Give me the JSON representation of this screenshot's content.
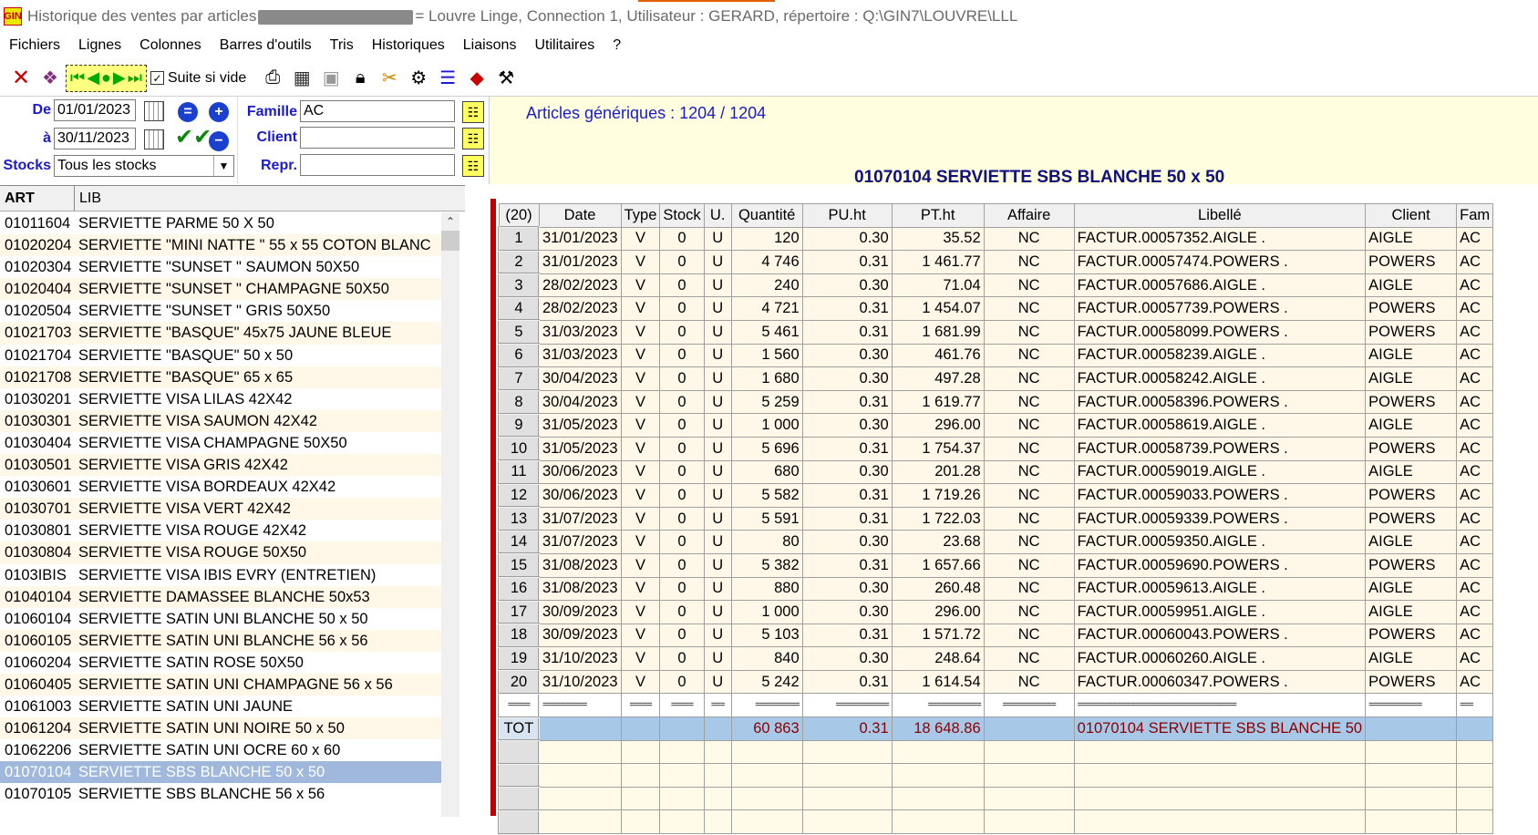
{
  "window": {
    "title_prefix": "Historique des ventes par articles",
    "title_suffix": "= Louvre Linge, Connection 1, Utilisateur : GERARD, répertoire : Q:\\GIN7\\LOUVRE\\LLL",
    "app_icon_text": "GIN"
  },
  "menu": [
    "Fichiers",
    "Lignes",
    "Colonnes",
    "Barres d'outils",
    "Tris",
    "Historiques",
    "Liaisons",
    "Utilitaires",
    "?"
  ],
  "toolbar": {
    "suite_label": "Suite si vide",
    "suite_checked": "✓",
    "nav_first": "⏮",
    "nav_prev": "◀",
    "nav_dot": "●",
    "nav_next": "▶",
    "nav_last": "⏭"
  },
  "filters": {
    "de_label": "De",
    "de_value": "01/01/2023",
    "a_label": "à",
    "a_value": "30/11/2023",
    "stocks_label": "Stocks",
    "stocks_value": "Tous les stocks",
    "famille_label": "Famille",
    "famille_value": "AC",
    "client_label": "Client",
    "client_value": "",
    "repr_label": "Repr.",
    "repr_value": ""
  },
  "info": {
    "count": "Articles génériques : 1204 / 1204",
    "article": "01070104 SERVIETTE SBS  BLANCHE 50 x 50"
  },
  "list": {
    "header_art": "ART",
    "header_lib": "LIB",
    "rows": [
      {
        "art": "01011604",
        "lib": "SERVIETTE  PARME 50 X 50"
      },
      {
        "art": "01020204",
        "lib": "SERVIETTE  \"MINI NATTE \" 55 x 55 COTON BLANC"
      },
      {
        "art": "01020304",
        "lib": "SERVIETTE  \"SUNSET \"  SAUMON 50X50"
      },
      {
        "art": "01020404",
        "lib": "SERVIETTE  \"SUNSET \"  CHAMPAGNE 50X50"
      },
      {
        "art": "01020504",
        "lib": "SERVIETTE  \"SUNSET \" GRIS 50X50"
      },
      {
        "art": "01021703",
        "lib": "SERVIETTE \"BASQUE\" 45x75 JAUNE BLEUE"
      },
      {
        "art": "01021704",
        "lib": "SERVIETTE  \"BASQUE\"  50 x 50"
      },
      {
        "art": "01021708",
        "lib": "SERVIETTE \"BASQUE\"  65 x 65"
      },
      {
        "art": "01030201",
        "lib": "SERVIETTE VISA  LILAS 42X42"
      },
      {
        "art": "01030301",
        "lib": "SERVIETTE VISA SAUMON 42X42"
      },
      {
        "art": "01030404",
        "lib": "SERVIETTE VISA CHAMPAGNE 50X50"
      },
      {
        "art": "01030501",
        "lib": "SERVIETTE VISA GRIS 42X42"
      },
      {
        "art": "01030601",
        "lib": "SERVIETTE VISA BORDEAUX 42X42"
      },
      {
        "art": "01030701",
        "lib": "SERVIETTE VISA VERT 42X42"
      },
      {
        "art": "01030801",
        "lib": "SERVIETTE VISA ROUGE 42X42"
      },
      {
        "art": "01030804",
        "lib": "SERVIETTE VISA ROUGE 50X50"
      },
      {
        "art": "0103IBIS",
        "lib": "SERVIETTE VISA IBIS EVRY (ENTRETIEN)"
      },
      {
        "art": "01040104",
        "lib": "SERVIETTE DAMASSEE BLANCHE 50x53"
      },
      {
        "art": "01060104",
        "lib": "SERVIETTE SATIN UNI BLANCHE 50 x 50"
      },
      {
        "art": "01060105",
        "lib": "SERVIETTE SATIN UNI BLANCHE 56 x 56"
      },
      {
        "art": "01060204",
        "lib": "SERVIETTE SATIN ROSE 50X50"
      },
      {
        "art": "01060405",
        "lib": "SERVIETTE SATIN UNI CHAMPAGNE 56 x 56"
      },
      {
        "art": "01061003",
        "lib": "SERVIETTE SATIN UNI JAUNE"
      },
      {
        "art": "01061204",
        "lib": "SERVIETTE SATIN UNI NOIRE 50 x 50"
      },
      {
        "art": "01062206",
        "lib": "SERVIETTE SATIN UNI OCRE 60 x 60"
      },
      {
        "art": "01070104",
        "lib": "SERVIETTE SBS  BLANCHE 50 x 50",
        "selected": true
      },
      {
        "art": "01070105",
        "lib": "SERVIETTE SBS  BLANCHE 56 x 56"
      }
    ]
  },
  "grid": {
    "columns": [
      "(20)",
      "Date",
      "Type",
      "Stock",
      "U.",
      "Quantité",
      "PU.ht",
      "PT.ht",
      "Affaire",
      "Libellé",
      "Client",
      "Fam"
    ],
    "rows": [
      [
        "1",
        "31/01/2023",
        "V",
        "0",
        "U",
        "120",
        "0.30",
        "35.52",
        "NC",
        "FACTUR.00057352.AIGLE  .",
        "AIGLE",
        "AC"
      ],
      [
        "2",
        "31/01/2023",
        "V",
        "0",
        "U",
        "4 746",
        "0.31",
        "1 461.77",
        "NC",
        "FACTUR.00057474.POWERS .",
        "POWERS",
        "AC"
      ],
      [
        "3",
        "28/02/2023",
        "V",
        "0",
        "U",
        "240",
        "0.30",
        "71.04",
        "NC",
        "FACTUR.00057686.AIGLE  .",
        "AIGLE",
        "AC"
      ],
      [
        "4",
        "28/02/2023",
        "V",
        "0",
        "U",
        "4 721",
        "0.31",
        "1 454.07",
        "NC",
        "FACTUR.00057739.POWERS .",
        "POWERS",
        "AC"
      ],
      [
        "5",
        "31/03/2023",
        "V",
        "0",
        "U",
        "5 461",
        "0.31",
        "1 681.99",
        "NC",
        "FACTUR.00058099.POWERS .",
        "POWERS",
        "AC"
      ],
      [
        "6",
        "31/03/2023",
        "V",
        "0",
        "U",
        "1 560",
        "0.30",
        "461.76",
        "NC",
        "FACTUR.00058239.AIGLE  .",
        "AIGLE",
        "AC"
      ],
      [
        "7",
        "30/04/2023",
        "V",
        "0",
        "U",
        "1 680",
        "0.30",
        "497.28",
        "NC",
        "FACTUR.00058242.AIGLE  .",
        "AIGLE",
        "AC"
      ],
      [
        "8",
        "30/04/2023",
        "V",
        "0",
        "U",
        "5 259",
        "0.31",
        "1 619.77",
        "NC",
        "FACTUR.00058396.POWERS .",
        "POWERS",
        "AC"
      ],
      [
        "9",
        "31/05/2023",
        "V",
        "0",
        "U",
        "1 000",
        "0.30",
        "296.00",
        "NC",
        "FACTUR.00058619.AIGLE  .",
        "AIGLE",
        "AC"
      ],
      [
        "10",
        "31/05/2023",
        "V",
        "0",
        "U",
        "5 696",
        "0.31",
        "1 754.37",
        "NC",
        "FACTUR.00058739.POWERS .",
        "POWERS",
        "AC"
      ],
      [
        "11",
        "30/06/2023",
        "V",
        "0",
        "U",
        "680",
        "0.30",
        "201.28",
        "NC",
        "FACTUR.00059019.AIGLE  .",
        "AIGLE",
        "AC"
      ],
      [
        "12",
        "30/06/2023",
        "V",
        "0",
        "U",
        "5 582",
        "0.31",
        "1 719.26",
        "NC",
        "FACTUR.00059033.POWERS .",
        "POWERS",
        "AC"
      ],
      [
        "13",
        "31/07/2023",
        "V",
        "0",
        "U",
        "5 591",
        "0.31",
        "1 722.03",
        "NC",
        "FACTUR.00059339.POWERS .",
        "POWERS",
        "AC"
      ],
      [
        "14",
        "31/07/2023",
        "V",
        "0",
        "U",
        "80",
        "0.30",
        "23.68",
        "NC",
        "FACTUR.00059350.AIGLE  .",
        "AIGLE",
        "AC"
      ],
      [
        "15",
        "31/08/2023",
        "V",
        "0",
        "U",
        "5 382",
        "0.31",
        "1 657.66",
        "NC",
        "FACTUR.00059690.POWERS .",
        "POWERS",
        "AC"
      ],
      [
        "16",
        "31/08/2023",
        "V",
        "0",
        "U",
        "880",
        "0.30",
        "260.48",
        "NC",
        "FACTUR.00059613.AIGLE  .",
        "AIGLE",
        "AC"
      ],
      [
        "17",
        "30/09/2023",
        "V",
        "0",
        "U",
        "1 000",
        "0.30",
        "296.00",
        "NC",
        "FACTUR.00059951.AIGLE  .",
        "AIGLE",
        "AC"
      ],
      [
        "18",
        "30/09/2023",
        "V",
        "0",
        "U",
        "5 103",
        "0.31",
        "1 571.72",
        "NC",
        "FACTUR.00060043.POWERS .",
        "POWERS",
        "AC"
      ],
      [
        "19",
        "31/10/2023",
        "V",
        "0",
        "U",
        "840",
        "0.30",
        "248.64",
        "NC",
        "FACTUR.00060260.AIGLE  .",
        "AIGLE",
        "AC"
      ],
      [
        "20",
        "31/10/2023",
        "V",
        "0",
        "U",
        "5 242",
        "0.31",
        "1 614.54",
        "NC",
        "FACTUR.00060347.POWERS .",
        "POWERS",
        "AC"
      ]
    ],
    "separator": [
      "=====",
      "==========",
      "=====",
      "=====",
      "===",
      "==========",
      "============",
      "============",
      "============",
      "====================================",
      "============",
      "==="
    ],
    "total": [
      "TOT",
      "",
      "",
      "",
      "",
      "60 863",
      "0.31",
      "18 648.86",
      "",
      "01070104 SERVIETTE SBS  BLANCHE 50",
      "",
      ""
    ],
    "empty_rows": 4
  }
}
